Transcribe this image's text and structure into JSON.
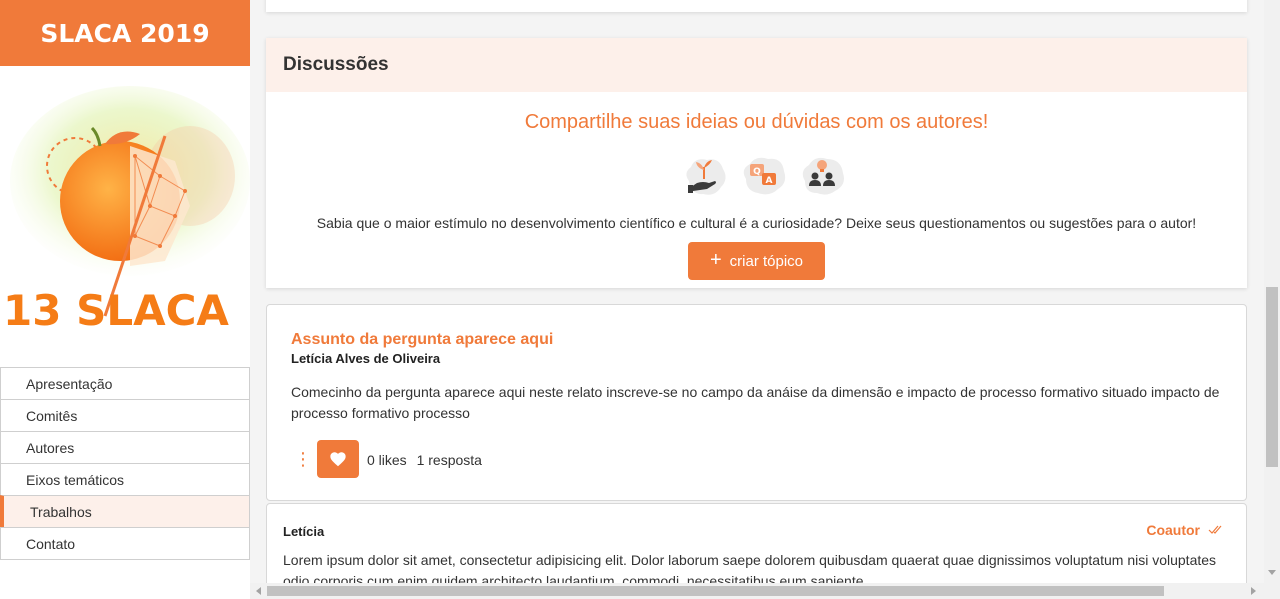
{
  "sidebar": {
    "title": "SLACA 2019",
    "logo_text": "13 SLACA",
    "items": [
      {
        "label": "Apresentação",
        "active": false
      },
      {
        "label": "Comitês",
        "active": false
      },
      {
        "label": "Autores",
        "active": false
      },
      {
        "label": "Eixos temáticos",
        "active": false
      },
      {
        "label": "Trabalhos",
        "active": true
      },
      {
        "label": "Contato",
        "active": false
      }
    ]
  },
  "discussions": {
    "title": "Discussões",
    "subtitle": "Compartilhe suas ideias ou dúvidas com os autores!",
    "icons": [
      "growth-hand-icon",
      "qa-chat-icon",
      "people-idea-icon"
    ],
    "description": "Sabia que o maior estímulo no desenvolvimento científico e cultural é a curiosidade? Deixe seus questionamentos ou sugestões para o autor!",
    "create_button": "criar tópico"
  },
  "question": {
    "title": "Assunto da pergunta aparece aqui",
    "author": "Letícia Alves de Oliveira",
    "body": "Comecinho da pergunta aparece aqui neste relato inscreve-se no campo da anáise da dimensão e impacto de processo formativo situado impacto de processo formativo processo",
    "likes": "0 likes",
    "replies": "1 resposta"
  },
  "reply": {
    "author": "Letícia",
    "role": "Coautor",
    "body": "Lorem ipsum dolor sit amet, consectetur adipisicing elit. Dolor laborum saepe dolorem quibusdam quaerat quae dignissimos voluptatum nisi voluptates odio corporis cum enim quidem architecto laudantium, commodi, necessitatibus eum sapiente"
  },
  "colors": {
    "accent": "#f07a3a",
    "accent_light": "#fdf0ea"
  }
}
